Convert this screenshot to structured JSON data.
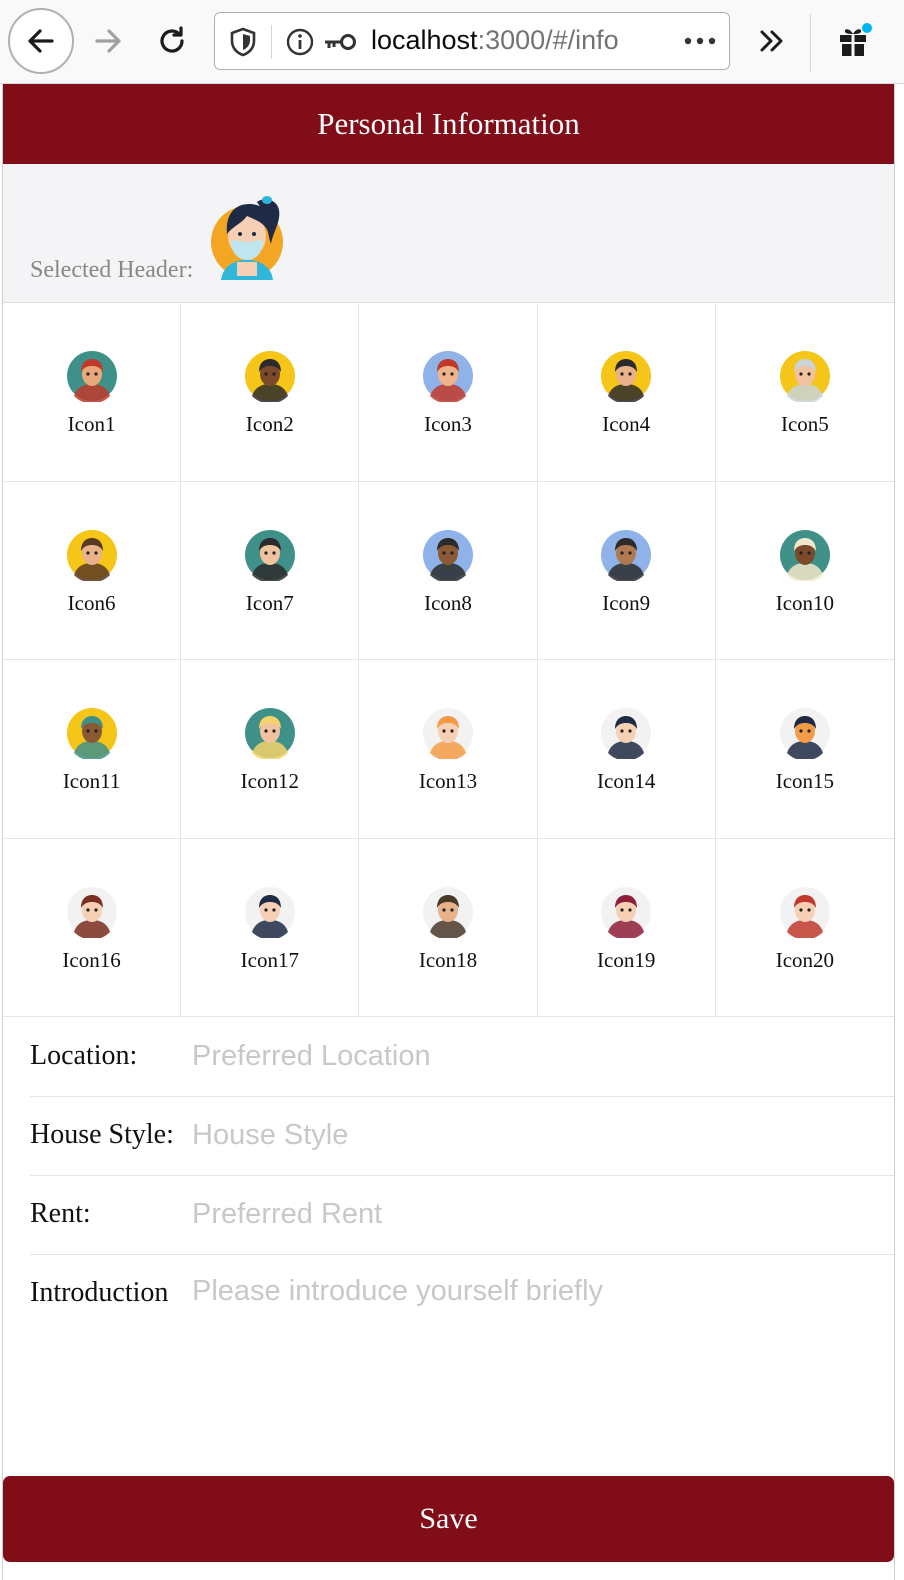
{
  "browser": {
    "url_host": "localhost",
    "url_rest": ":3000/#/info",
    "icons": {
      "back": "back-arrow-icon",
      "forward": "forward-arrow-icon",
      "reload": "reload-icon",
      "shield": "shield-icon",
      "info": "info-icon",
      "key": "key-icon",
      "more": "more-dots-icon",
      "overflow": "chevron-double-right-icon",
      "gift": "gift-icon"
    }
  },
  "header": {
    "title": "Personal Information"
  },
  "selected": {
    "label": "Selected Header:"
  },
  "icons": [
    {
      "label": "Icon1",
      "bg": "#3f9089",
      "skin": "#e9a87b",
      "hair": "#c0392b"
    },
    {
      "label": "Icon2",
      "bg": "#f5c518",
      "skin": "#7a4a2a",
      "hair": "#2b2b2b"
    },
    {
      "label": "Icon3",
      "bg": "#8fb2e8",
      "skin": "#f1b38c",
      "hair": "#c0392b"
    },
    {
      "label": "Icon4",
      "bg": "#f5c518",
      "skin": "#e9b28a",
      "hair": "#2b2b2b"
    },
    {
      "label": "Icon5",
      "bg": "#f5c518",
      "skin": "#f1c29f",
      "hair": "#c8d4d8"
    },
    {
      "label": "Icon6",
      "bg": "#f5c518",
      "skin": "#e9b28a",
      "hair": "#5a3a22"
    },
    {
      "label": "Icon7",
      "bg": "#3f9089",
      "skin": "#f1c29f",
      "hair": "#2b2b2b"
    },
    {
      "label": "Icon8",
      "bg": "#8fb2e8",
      "skin": "#8a5a34",
      "hair": "#2b2b2b"
    },
    {
      "label": "Icon9",
      "bg": "#8fb2e8",
      "skin": "#b07a50",
      "hair": "#2b2b2b"
    },
    {
      "label": "Icon10",
      "bg": "#3f9089",
      "skin": "#7a4a2a",
      "hair": "#f2e8c9"
    },
    {
      "label": "Icon11",
      "bg": "#f5c518",
      "skin": "#8a5a34",
      "hair": "#3f9089"
    },
    {
      "label": "Icon12",
      "bg": "#3f9089",
      "skin": "#f1c29f",
      "hair": "#f5d36a"
    },
    {
      "label": "Icon13",
      "bg": "#ffffff",
      "skin": "#f6d0b4",
      "hair": "#f39c45"
    },
    {
      "label": "Icon14",
      "bg": "#ffffff",
      "skin": "#f6d0b4",
      "hair": "#1f2a44"
    },
    {
      "label": "Icon15",
      "bg": "#ffffff",
      "skin": "#f39c45",
      "hair": "#1f2a44"
    },
    {
      "label": "Icon16",
      "bg": "#ffffff",
      "skin": "#f6d0b4",
      "hair": "#7a2e1f"
    },
    {
      "label": "Icon17",
      "bg": "#ffffff",
      "skin": "#f6d0b4",
      "hair": "#1f2a44"
    },
    {
      "label": "Icon18",
      "bg": "#ffffff",
      "skin": "#e9b28a",
      "hair": "#4a3a2a"
    },
    {
      "label": "Icon19",
      "bg": "#ffffff",
      "skin": "#f6d0b4",
      "hair": "#8e1f3a"
    },
    {
      "label": "Icon20",
      "bg": "#ffffff",
      "skin": "#f6d0b4",
      "hair": "#c0392b"
    }
  ],
  "form": {
    "location": {
      "label": "Location:",
      "placeholder": "Preferred Location",
      "value": ""
    },
    "house_style": {
      "label": "House Style:",
      "placeholder": "House Style",
      "value": ""
    },
    "rent": {
      "label": "Rent:",
      "placeholder": "Preferred Rent",
      "value": ""
    },
    "introduction": {
      "label": "Introduction",
      "placeholder": "Please introduce yourself briefly",
      "value": ""
    }
  },
  "save_label": "Save",
  "colors": {
    "brand": "#800d18",
    "panel": "#f4f4f7",
    "placeholder": "#c8c8c8"
  }
}
